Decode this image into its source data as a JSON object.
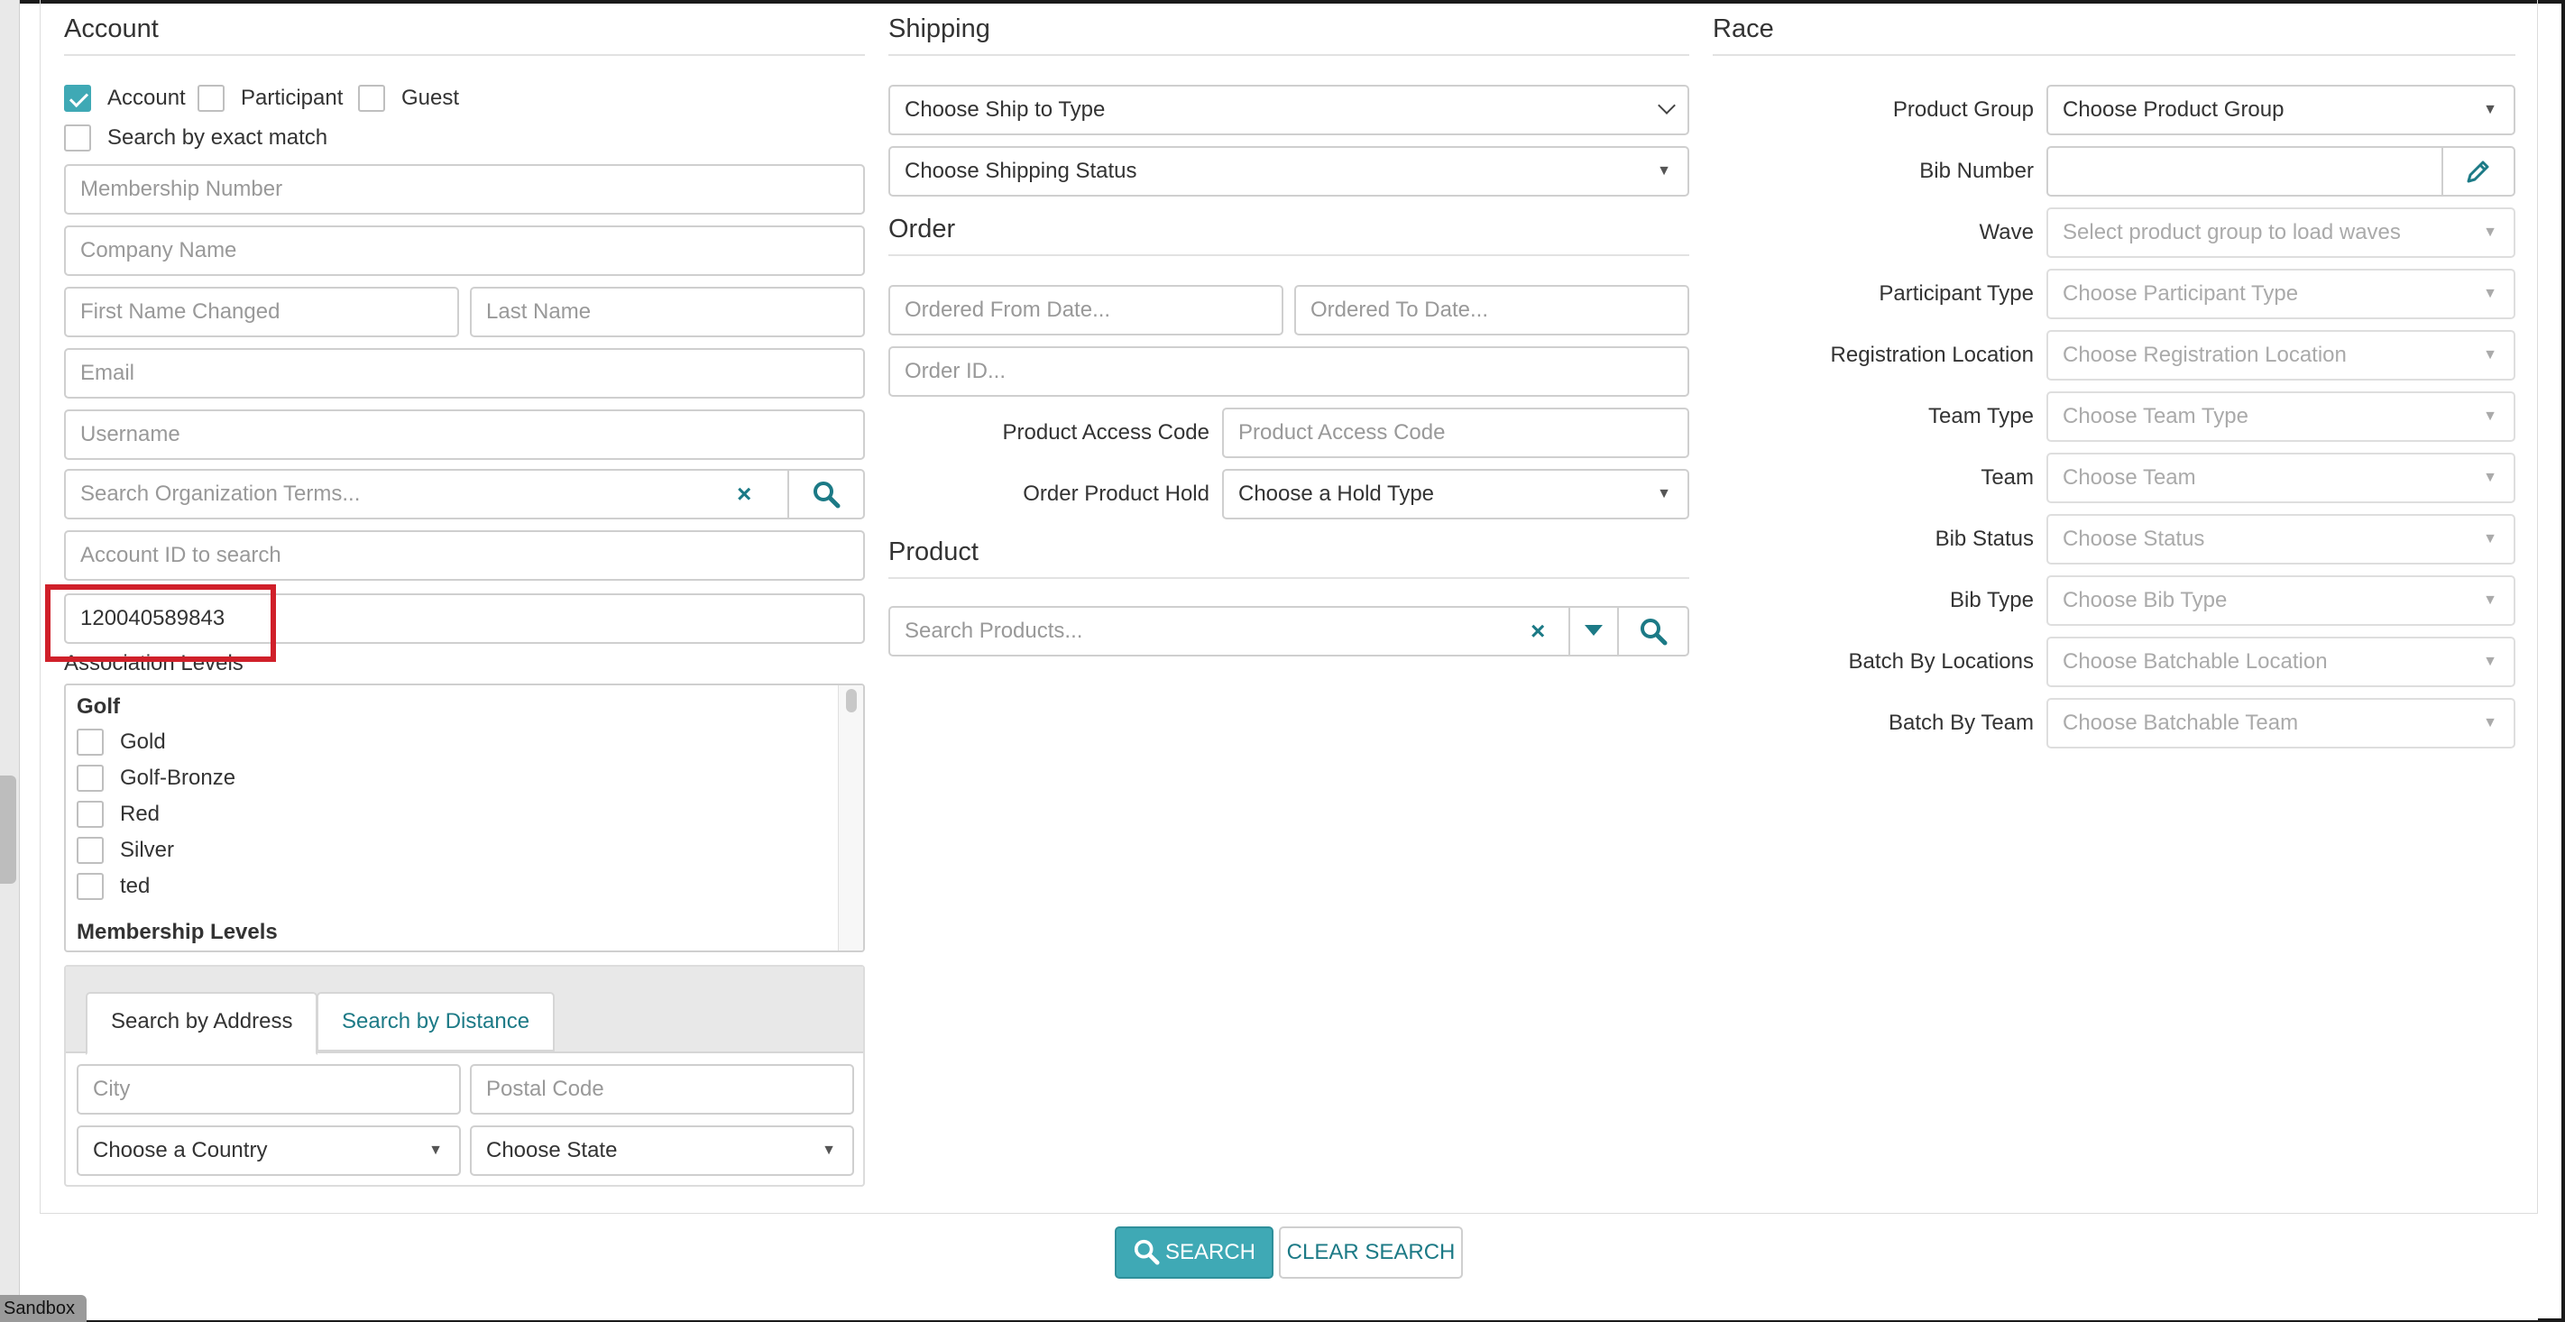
{
  "account": {
    "title": "Account",
    "checkboxes": [
      {
        "label": "Account",
        "checked": true
      },
      {
        "label": "Participant",
        "checked": false
      },
      {
        "label": "Guest",
        "checked": false
      }
    ],
    "exact_match_label": "Search by exact match",
    "membership_placeholder": "Membership Number",
    "company_placeholder": "Company Name",
    "first_name_placeholder": "First Name Changed",
    "last_name_placeholder": "Last Name",
    "email_placeholder": "Email",
    "username_placeholder": "Username",
    "org_terms_placeholder": "Search Organization Terms...",
    "account_id_placeholder": "Account ID to search",
    "account_id_value": "120040589843",
    "association_levels_label": "Association Levels",
    "groups": [
      {
        "name": "Golf",
        "levels": [
          "Gold",
          "Golf-Bronze",
          "Red",
          "Silver",
          "ted"
        ]
      },
      {
        "name": "Membership Levels",
        "levels": []
      }
    ],
    "address_tabs": [
      "Search by Address",
      "Search by Distance"
    ],
    "city_placeholder": "City",
    "postal_placeholder": "Postal Code",
    "country_select": "Choose a Country",
    "state_select": "Choose State"
  },
  "shipping": {
    "title": "Shipping",
    "ship_type_select": "Choose Ship to Type",
    "shipping_status_select": "Choose Shipping Status"
  },
  "order": {
    "title": "Order",
    "from_date_placeholder": "Ordered From Date...",
    "to_date_placeholder": "Ordered To Date...",
    "order_id_placeholder": "Order ID...",
    "access_code_label": "Product Access Code",
    "access_code_placeholder": "Product Access Code",
    "hold_label": "Order Product Hold",
    "hold_select": "Choose a Hold Type"
  },
  "product": {
    "title": "Product",
    "search_placeholder": "Search Products..."
  },
  "race": {
    "title": "Race",
    "fields": [
      {
        "label": "Product Group",
        "value": "Choose Product Group",
        "kind": "select"
      },
      {
        "label": "Bib Number",
        "value": "",
        "kind": "input-edit"
      },
      {
        "label": "Wave",
        "value": "Select product group to load waves",
        "kind": "select-disabled"
      },
      {
        "label": "Participant Type",
        "value": "Choose Participant Type",
        "kind": "select-disabled"
      },
      {
        "label": "Registration Location",
        "value": "Choose Registration Location",
        "kind": "select-disabled"
      },
      {
        "label": "Team Type",
        "value": "Choose Team Type",
        "kind": "select-disabled"
      },
      {
        "label": "Team",
        "value": "Choose Team",
        "kind": "select-disabled"
      },
      {
        "label": "Bib Status",
        "value": "Choose Status",
        "kind": "select-disabled"
      },
      {
        "label": "Bib Type",
        "value": "Choose Bib Type",
        "kind": "select-disabled"
      },
      {
        "label": "Batch By Locations",
        "value": "Choose Batchable Location",
        "kind": "select-disabled"
      },
      {
        "label": "Batch By Team",
        "value": "Choose Batchable Team",
        "kind": "select-disabled"
      }
    ]
  },
  "actions": {
    "search_label": "SEARCH",
    "clear_label": "CLEAR SEARCH"
  },
  "sandbox_label": "Sandbox",
  "colors": {
    "accent": "#3fa9b5",
    "accent_dark": "#1c7a86",
    "highlight": "#d0202a"
  },
  "icons": {
    "search": "search-icon",
    "clear": "close-icon",
    "edit": "pencil-icon",
    "dropdown": "caret-down-icon"
  }
}
